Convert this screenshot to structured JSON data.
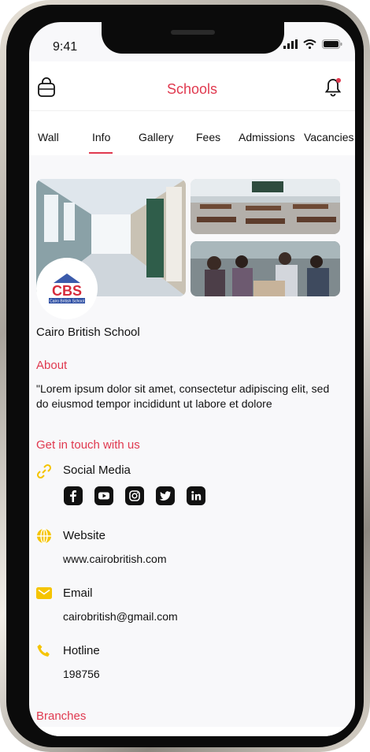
{
  "status_bar": {
    "time": "9:41"
  },
  "header": {
    "title": "Schools",
    "left_icon": "bag-icon",
    "right_icon": "bell-icon"
  },
  "tabs": [
    {
      "label": "Wall"
    },
    {
      "label": "Info"
    },
    {
      "label": "Gallery"
    },
    {
      "label": "Fees"
    },
    {
      "label": "Admissions"
    },
    {
      "label": "Vacancies"
    }
  ],
  "active_tab": "Info",
  "school": {
    "name": "Cairo British School",
    "logo_text": "CBS",
    "logo_caption": "Cairo British School"
  },
  "about": {
    "heading": "About",
    "text": "\"Lorem ipsum dolor sit amet, consectetur adipiscing elit, sed do eiusmod tempor incididunt ut labore et dolore"
  },
  "contact": {
    "heading": "Get in touch with us",
    "social_media": {
      "label": "Social Media",
      "icons": [
        "facebook-icon",
        "youtube-icon",
        "instagram-icon",
        "twitter-icon",
        "linkedin-icon"
      ]
    },
    "website": {
      "label": "Website",
      "value": "www.cairobritish.com"
    },
    "email": {
      "label": "Email",
      "value": "cairobritish@gmail.com"
    },
    "hotline": {
      "label": "Hotline",
      "value": "198756"
    }
  },
  "branches": {
    "heading": "Branches"
  },
  "colors": {
    "accent": "#e0394f",
    "icon_yellow": "#f5c400"
  }
}
